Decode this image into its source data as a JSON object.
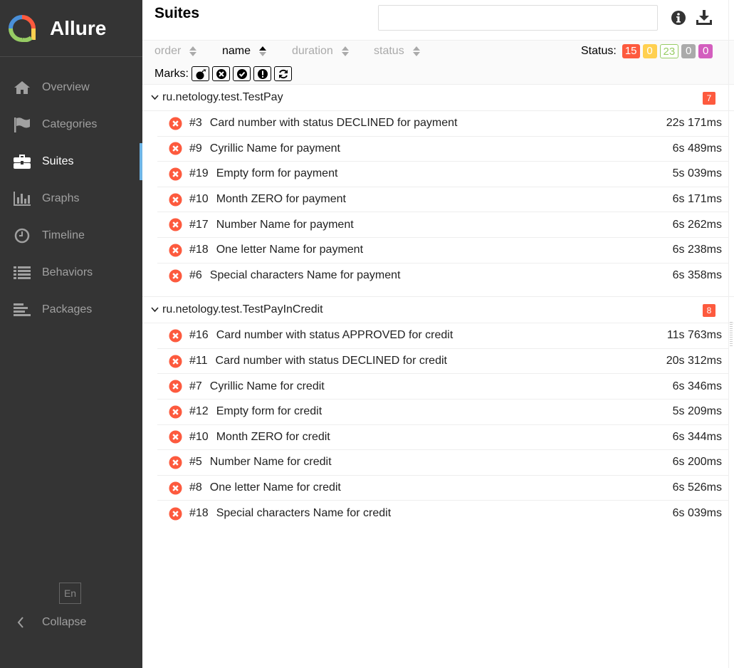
{
  "app": {
    "name": "Allure"
  },
  "sidebar": {
    "items": [
      {
        "label": "Overview",
        "icon": "home-icon"
      },
      {
        "label": "Categories",
        "icon": "flag-icon"
      },
      {
        "label": "Suites",
        "icon": "briefcase-icon",
        "active": true
      },
      {
        "label": "Graphs",
        "icon": "bar-chart-icon"
      },
      {
        "label": "Timeline",
        "icon": "clock-icon"
      },
      {
        "label": "Behaviors",
        "icon": "list-icon"
      },
      {
        "label": "Packages",
        "icon": "align-left-icon"
      }
    ],
    "language": "En",
    "collapse_label": "Collapse"
  },
  "header": {
    "title": "Suites",
    "search_value": ""
  },
  "toolbar": {
    "sort": {
      "order": "order",
      "name": "name",
      "duration": "duration",
      "status": "status"
    },
    "status_label": "Status:",
    "status_counts": [
      {
        "value": "15",
        "color": "#fd5a3e",
        "filled": true
      },
      {
        "value": "0",
        "color": "#ffd050",
        "filled": true
      },
      {
        "value": "23",
        "color": "#97cc64",
        "filled": false
      },
      {
        "value": "0",
        "color": "#aaaaaa",
        "filled": true
      },
      {
        "value": "0",
        "color": "#d35ebe",
        "filled": true
      }
    ],
    "marks_label": "Marks:"
  },
  "suites": [
    {
      "name": "ru.netology.test.TestPay",
      "count": "7",
      "tests": [
        {
          "num": "#3",
          "name": "Card number with status DECLINED for payment",
          "duration": "22s 171ms"
        },
        {
          "num": "#9",
          "name": "Cyrillic Name for payment",
          "duration": "6s 489ms"
        },
        {
          "num": "#19",
          "name": "Empty form for payment",
          "duration": "5s 039ms"
        },
        {
          "num": "#10",
          "name": "Month ZERO for payment",
          "duration": "6s 171ms"
        },
        {
          "num": "#17",
          "name": "Number Name for payment",
          "duration": "6s 262ms"
        },
        {
          "num": "#18",
          "name": "One letter Name for payment",
          "duration": "6s 238ms"
        },
        {
          "num": "#6",
          "name": "Special characters Name for payment",
          "duration": "6s 358ms"
        }
      ]
    },
    {
      "name": "ru.netology.test.TestPayInCredit",
      "count": "8",
      "tests": [
        {
          "num": "#16",
          "name": "Card number with status APPROVED for credit",
          "duration": "11s 763ms"
        },
        {
          "num": "#11",
          "name": "Card number with status DECLINED for credit",
          "duration": "20s 312ms"
        },
        {
          "num": "#7",
          "name": "Cyrillic Name for credit",
          "duration": "6s 346ms"
        },
        {
          "num": "#12",
          "name": "Empty form for credit",
          "duration": "5s 209ms"
        },
        {
          "num": "#10",
          "name": "Month ZERO for credit",
          "duration": "6s 344ms"
        },
        {
          "num": "#5",
          "name": "Number Name for credit",
          "duration": "6s 200ms"
        },
        {
          "num": "#8",
          "name": "One letter Name for credit",
          "duration": "6s 526ms"
        },
        {
          "num": "#18",
          "name": "Special characters Name for credit",
          "duration": "6s 039ms"
        }
      ]
    }
  ]
}
